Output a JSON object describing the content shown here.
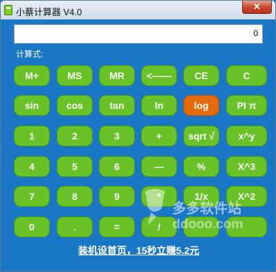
{
  "window": {
    "title": "小蔡计算器 V4.0",
    "close_glyph": "✕"
  },
  "display": {
    "value": "0"
  },
  "expression_label": "计算式:",
  "buttons": {
    "row1": [
      "M+",
      "MS",
      "MR",
      "<——",
      "CE",
      "C"
    ],
    "row2": [
      "sin",
      "cos",
      "tan",
      "ln",
      "log",
      "PI π"
    ],
    "row3": [
      "1",
      "2",
      "3",
      "+",
      "sqrt √",
      "x^y"
    ],
    "row4": [
      "4",
      "5",
      "6",
      "—",
      "%",
      "X^3"
    ],
    "row5": [
      "7",
      "8",
      "9",
      "*",
      "1/x",
      "X^2"
    ],
    "row6": [
      "0",
      ".",
      "=",
      "/",
      "",
      ""
    ]
  },
  "promo": {
    "text": "装机设首页，15秒立赚5.2元"
  },
  "watermark": {
    "name_cn": "多多软件站",
    "domain": "ddooo.com"
  },
  "colors": {
    "background": "#1977c5",
    "button": "#69c228",
    "highlight": "#e56a0c"
  }
}
